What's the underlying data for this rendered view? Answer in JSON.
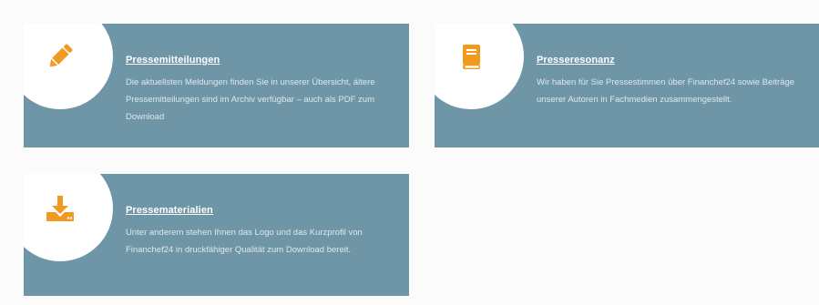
{
  "colors": {
    "card_background": "#6e96a6",
    "icon_accent": "#f29a1f",
    "circle": "#ffffff"
  },
  "cards": [
    {
      "icon": "pencil-icon",
      "title": "Pressemitteilungen",
      "text": "Die aktuellsten Meldungen finden Sie in unserer Übersicht, ältere Pressemitteilungen sind im Archiv verfügbar – auch als PDF zum Download"
    },
    {
      "icon": "book-icon",
      "title": "Presseresonanz",
      "text": "Wir haben für Sie Pressestimmen über Financhef24 sowie Beiträge unserer Autoren in Fachmedien zusammengestellt."
    },
    {
      "icon": "download-icon",
      "title": "Pressematerialien",
      "text": "Unter anderem stehen Ihnen das Logo und das Kurzprofil von Financhef24 in druckfähiger Qualität zum Download bereit."
    }
  ]
}
